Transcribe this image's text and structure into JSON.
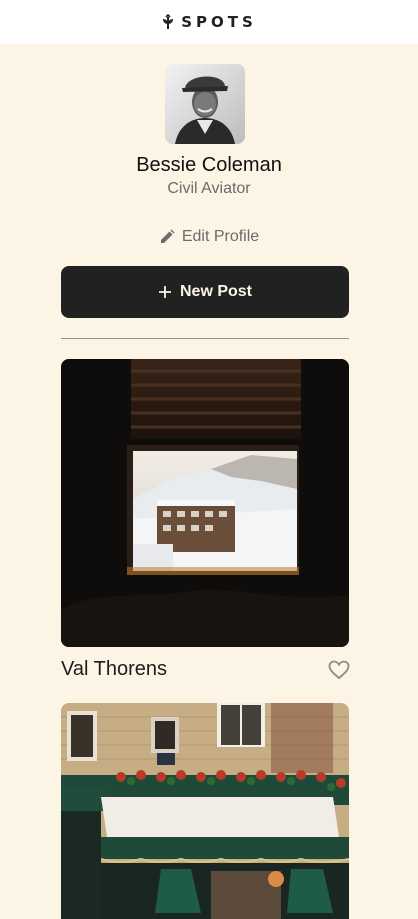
{
  "header": {
    "logo_text": "SPOTS",
    "logo_icon": "sprout-icon"
  },
  "profile": {
    "name": "Bessie Coleman",
    "role": "Civil Aviator",
    "avatar_icon": "avatar-photo",
    "edit_label": "Edit Profile",
    "edit_icon": "pencil-icon"
  },
  "actions": {
    "new_post_label": "New Post",
    "new_post_icon": "plus-icon"
  },
  "cards": [
    {
      "title": "Val Thorens",
      "liked": false,
      "like_icon": "heart-icon"
    },
    {
      "title": "",
      "image": "restaurant-storefront-photo"
    }
  ],
  "colors": {
    "background": "#fcf5e5",
    "header": "#ffffff",
    "button": "#212121",
    "button_text": "#fcf5e5",
    "muted_text": "#6b6b6b",
    "divider": "#9a9388"
  }
}
